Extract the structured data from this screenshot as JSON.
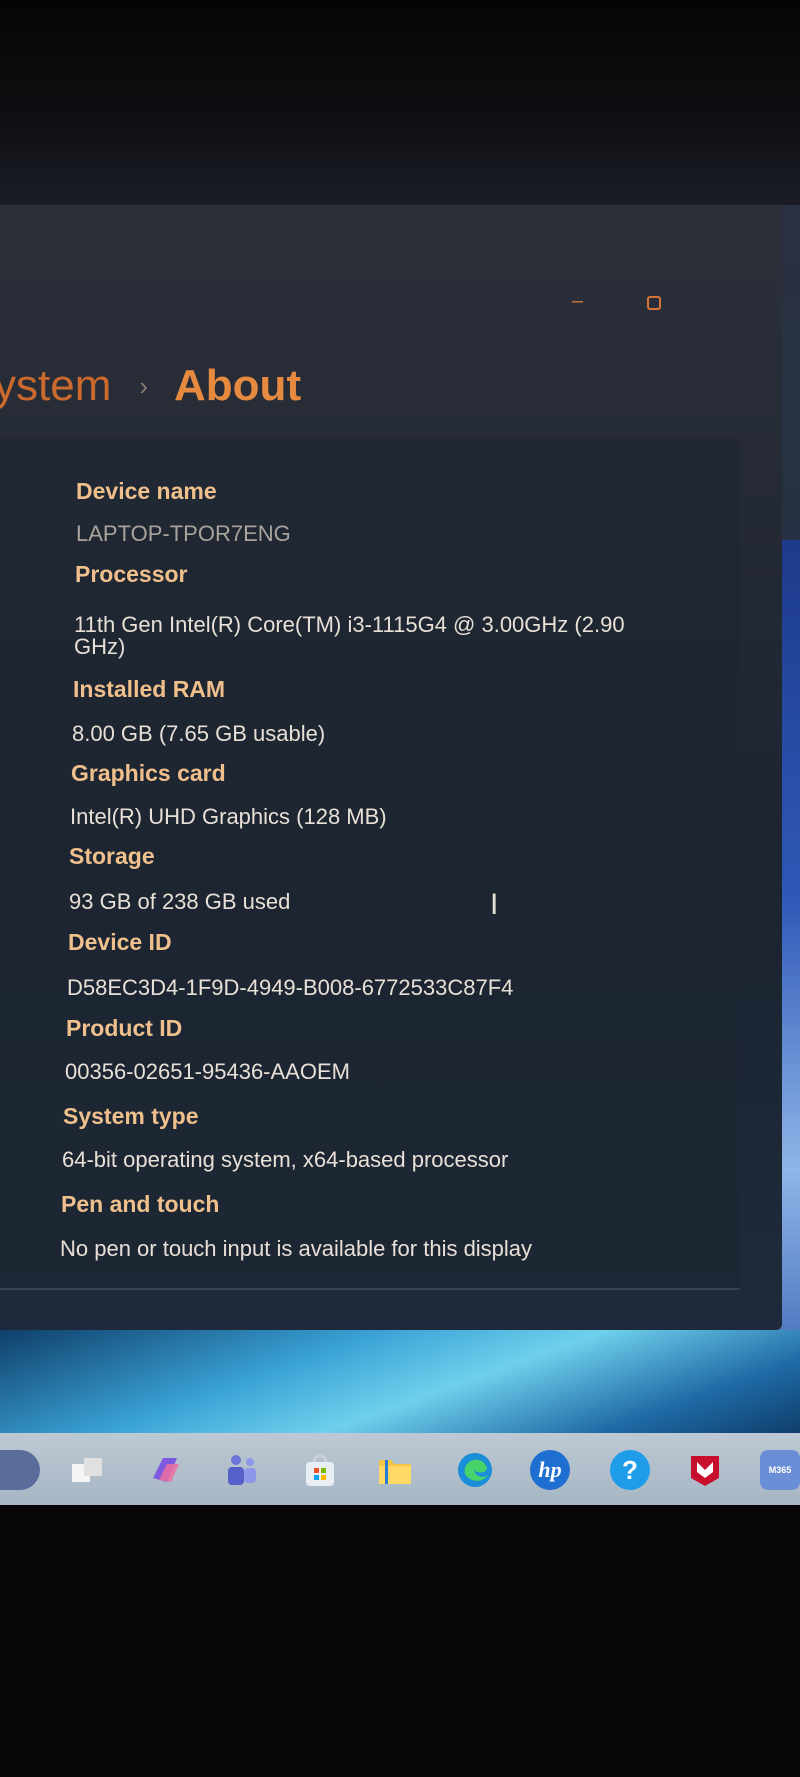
{
  "breadcrumb": {
    "parent": "ystem",
    "separator": "›",
    "current": "About"
  },
  "specs": [
    {
      "label": "Device name",
      "value": "LAPTOP-TPOR7ENG"
    },
    {
      "label": "Processor",
      "value": "11th Gen Intel(R) Core(TM) i3-1115G4 @ 3.00GHz (2.90",
      "value2": "GHz)"
    },
    {
      "label": "Installed RAM",
      "value": "8.00 GB (7.65 GB usable)"
    },
    {
      "label": "Graphics card",
      "value": "Intel(R) UHD Graphics (128 MB)"
    },
    {
      "label": "Storage",
      "value": "93 GB of 238 GB used"
    },
    {
      "label": "Device ID",
      "value": "D58EC3D4-1F9D-4949-B008-6772533C87F4"
    },
    {
      "label": "Product ID",
      "value": "00356-02651-95436-AAOEM"
    },
    {
      "label": "System type",
      "value": "64-bit operating system, x64-based processor"
    },
    {
      "label": "Pen and touch",
      "value": "No pen or touch input is available for this display"
    }
  ],
  "taskbar": {
    "hp_label": "hp",
    "help_label": "?",
    "m365_label": "M365"
  },
  "colors": {
    "accent": "#e58a3f",
    "label": "#f0c08c",
    "value": "#e8e0d6"
  }
}
